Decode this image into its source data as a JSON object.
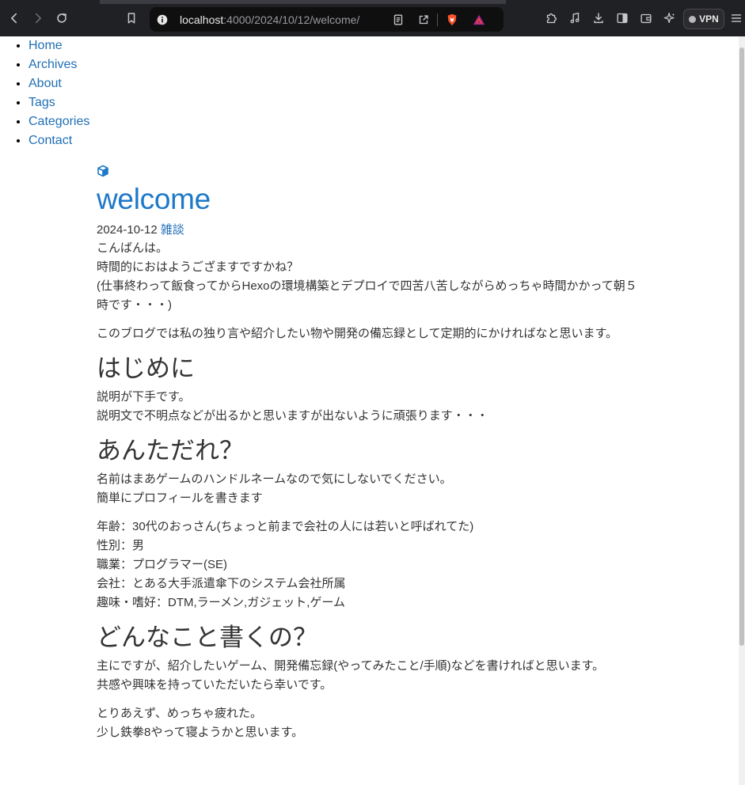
{
  "browser": {
    "url_host": "localhost",
    "url_path": ":4000/2024/10/12/welcome/",
    "vpn_label": "VPN"
  },
  "nav": {
    "items": [
      "Home",
      "Archives",
      "About",
      "Tags",
      "Categories",
      "Contact"
    ]
  },
  "post": {
    "title": "welcome",
    "date": "2024-10-12",
    "category": "雑談",
    "intro": [
      "こんばんは。",
      "時間的におはようござますですかね？",
      "(仕事終わって飯食ってからHexoの環境構築とデプロイで四苦八苦しながらめっちゃ時間かかって朝５時です・・・)"
    ],
    "intro2": "このブログでは私の独り言や紹介したい物や開発の備忘録として定期的にかければなと思います。",
    "sections": [
      {
        "heading": "はじめに",
        "paragraphs": [
          [
            "説明が下手です。",
            "説明文で不明点などが出るかと思いますが出ないように頑張ります・・・"
          ]
        ]
      },
      {
        "heading": "あんただれ？",
        "paragraphs": [
          [
            "名前はまあゲームのハンドルネームなので気にしないでください。",
            "簡単にプロフィールを書きます"
          ],
          [
            "年齢：30代のおっさん(ちょっと前まで会社の人には若いと呼ばれてた)",
            "性別：男",
            "職業：プログラマー(SE)",
            "会社：とある大手派遣傘下のシステム会社所属",
            "趣味・嗜好：DTM,ラーメン,ガジェット,ゲーム"
          ]
        ]
      },
      {
        "heading": "どんなこと書くの？",
        "paragraphs": [
          [
            "主にですが、紹介したいゲーム、開発備忘録(やってみたこと/手順)などを書ければと思います。",
            "共感や興味を持っていただいたら幸いです。"
          ],
          [
            "とりあえず、めっちゃ疲れた。",
            "少し鉄拳8やって寝ようかと思います。"
          ]
        ]
      }
    ]
  }
}
